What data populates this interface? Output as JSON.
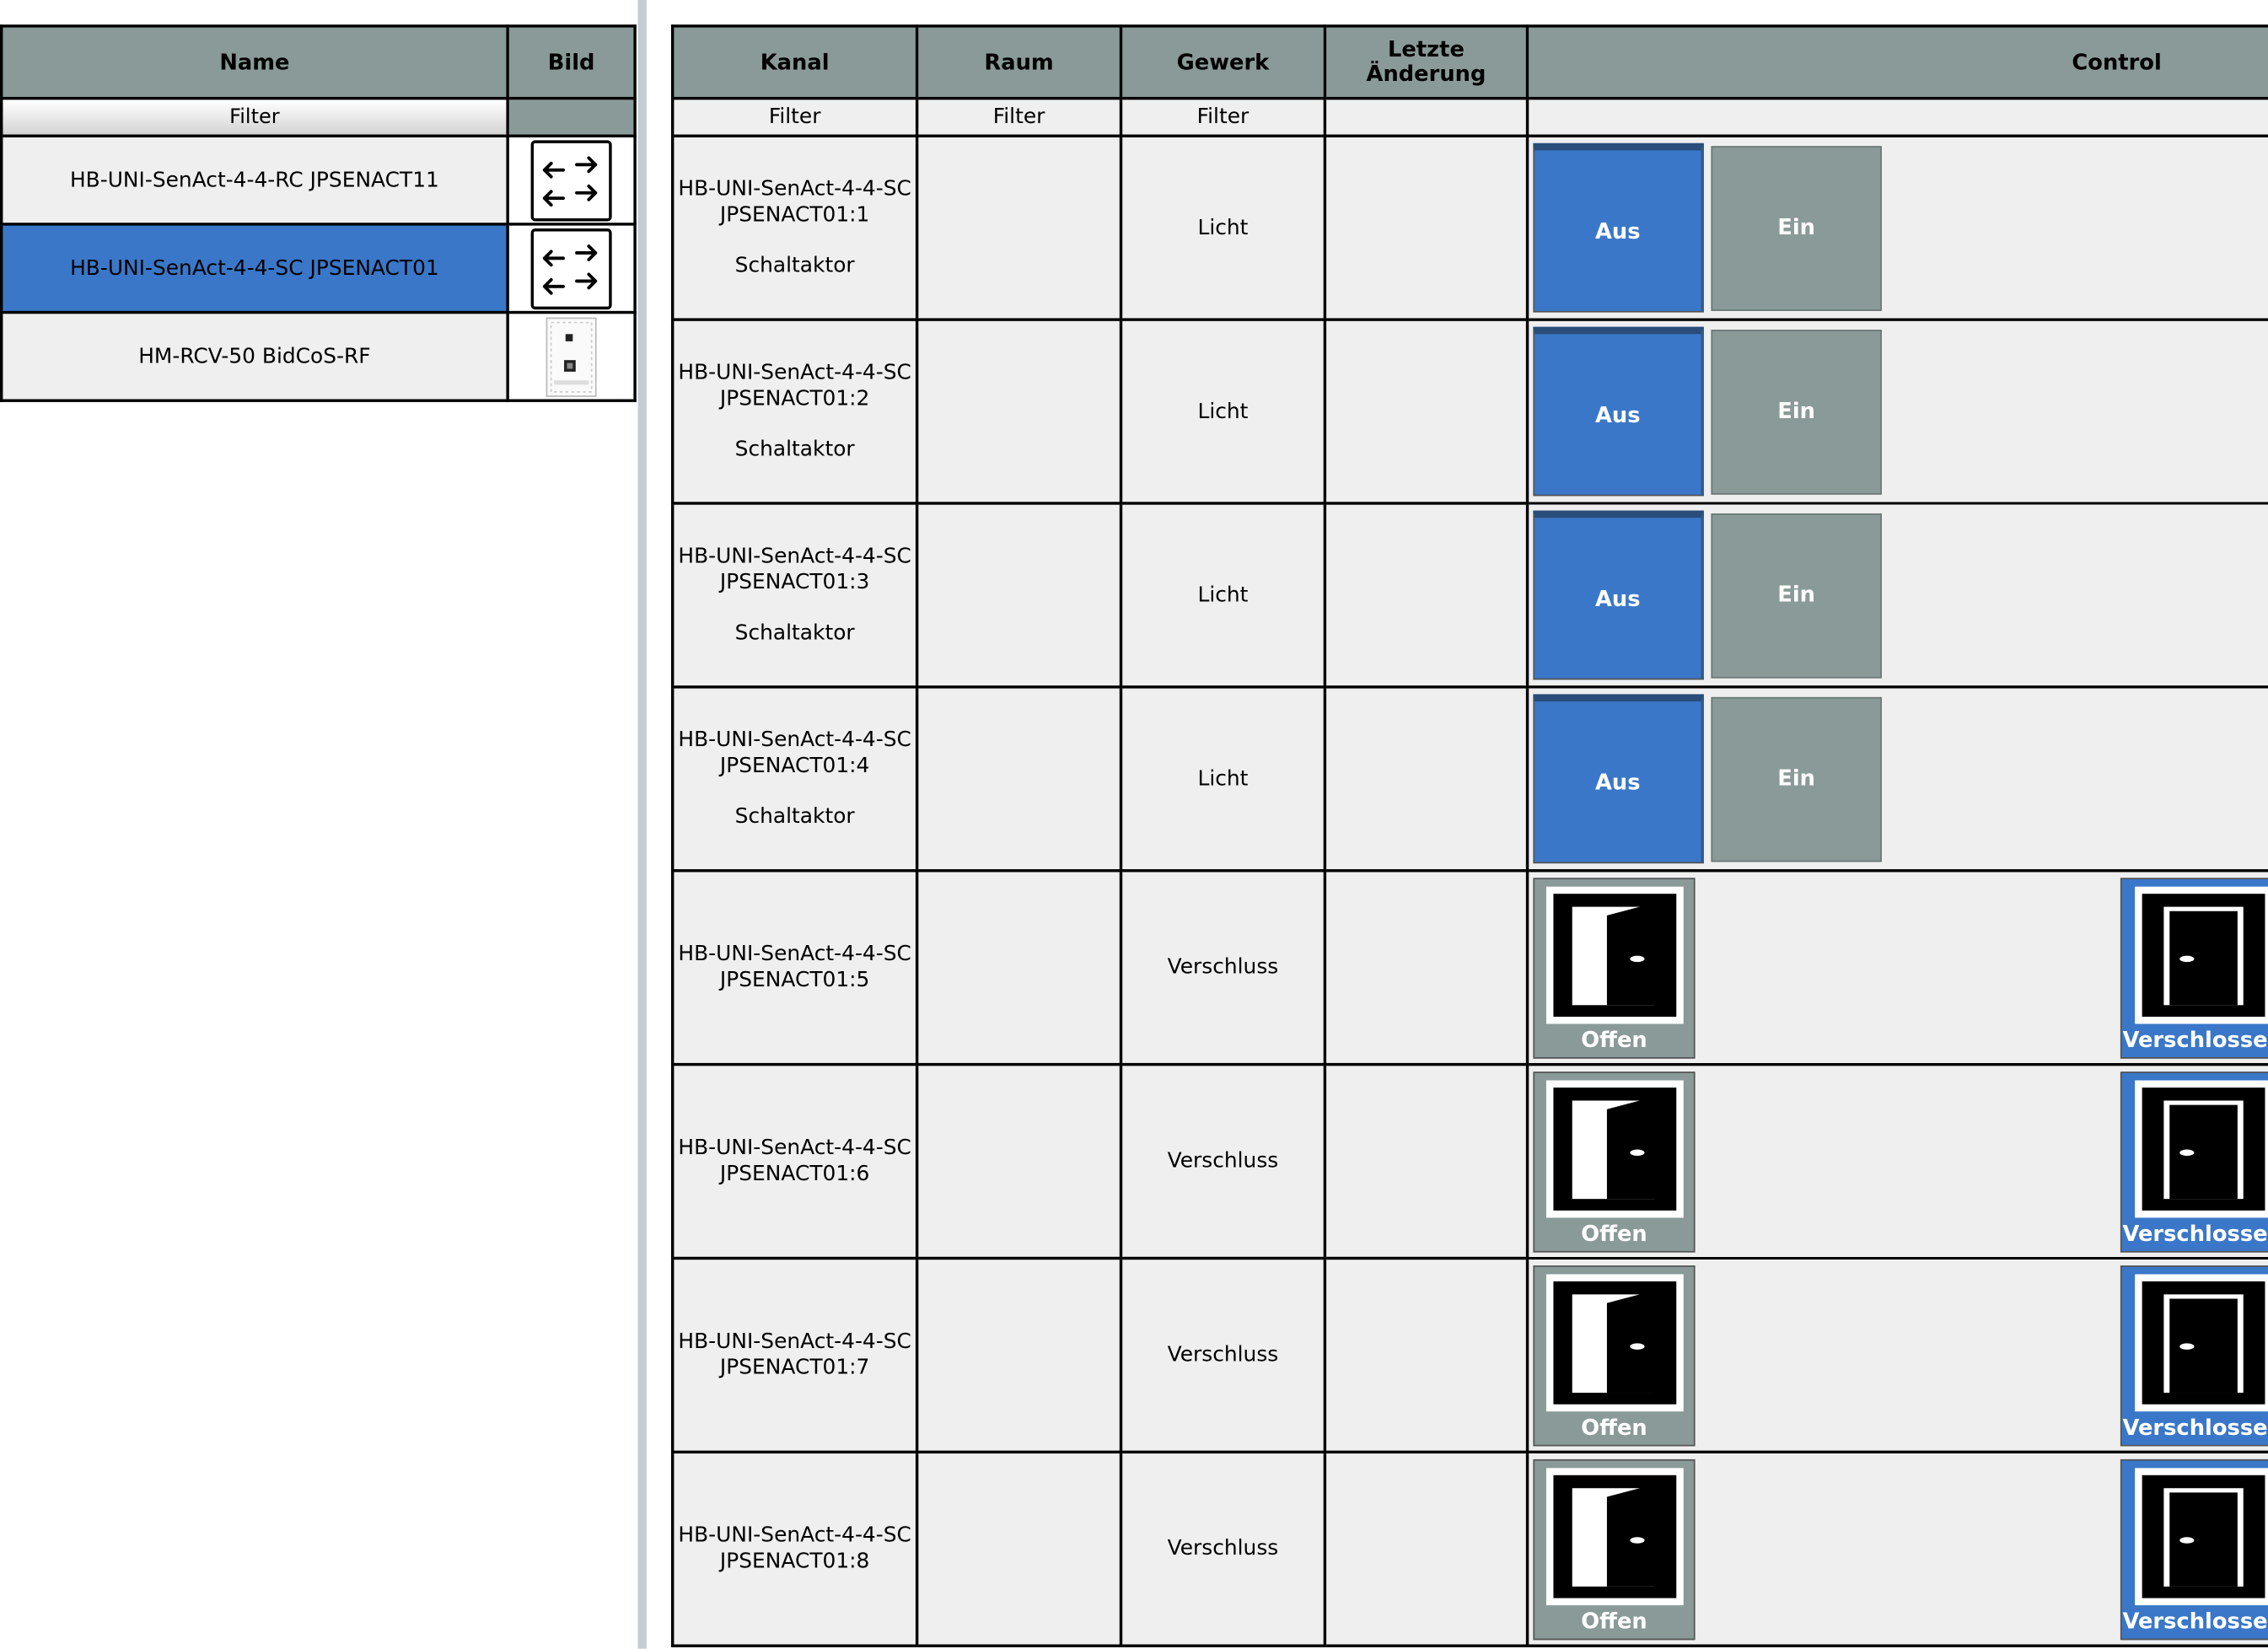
{
  "devices": {
    "headers": {
      "name": "Name",
      "image": "Bild"
    },
    "filter_label": "Filter",
    "rows": [
      {
        "name": "HB-UNI-SenAct-4-4-RC JPSENACT11",
        "icon": "arrows-icon",
        "selected": false
      },
      {
        "name": "HB-UNI-SenAct-4-4-SC JPSENACT01",
        "icon": "arrows-icon",
        "selected": true
      },
      {
        "name": "HM-RCV-50 BidCoS-RF",
        "icon": "rcv-device-icon",
        "selected": false
      }
    ]
  },
  "channels": {
    "headers": {
      "kanal": "Kanal",
      "raum": "Raum",
      "gewerk": "Gewerk",
      "letzte_line1": "Letzte",
      "letzte_line2": "Änderung",
      "control": "Control"
    },
    "filters": {
      "kanal": "Filter",
      "raum": "Filter",
      "gewerk": "Filter"
    },
    "switch_rows": [
      {
        "line1": "HB-UNI-SenAct-4-4-SC",
        "line2": "JPSENACT01:1",
        "type": "Schaltaktor",
        "raum": "",
        "gewerk": "Licht",
        "letzte": "",
        "off_label": "Aus",
        "on_label": "Ein",
        "state": "off"
      },
      {
        "line1": "HB-UNI-SenAct-4-4-SC",
        "line2": "JPSENACT01:2",
        "type": "Schaltaktor",
        "raum": "",
        "gewerk": "Licht",
        "letzte": "",
        "off_label": "Aus",
        "on_label": "Ein",
        "state": "off"
      },
      {
        "line1": "HB-UNI-SenAct-4-4-SC",
        "line2": "JPSENACT01:3",
        "type": "Schaltaktor",
        "raum": "",
        "gewerk": "Licht",
        "letzte": "",
        "off_label": "Aus",
        "on_label": "Ein",
        "state": "off"
      },
      {
        "line1": "HB-UNI-SenAct-4-4-SC",
        "line2": "JPSENACT01:4",
        "type": "Schaltaktor",
        "raum": "",
        "gewerk": "Licht",
        "letzte": "",
        "off_label": "Aus",
        "on_label": "Ein",
        "state": "off"
      }
    ],
    "lock_rows": [
      {
        "line1": "HB-UNI-SenAct-4-4-SC",
        "line2": "JPSENACT01:5",
        "raum": "",
        "gewerk": "Verschluss",
        "letzte": "",
        "open_label": "Offen",
        "closed_label": "Verschlossen",
        "state": "closed"
      },
      {
        "line1": "HB-UNI-SenAct-4-4-SC",
        "line2": "JPSENACT01:6",
        "raum": "",
        "gewerk": "Verschluss",
        "letzte": "",
        "open_label": "Offen",
        "closed_label": "Verschlossen",
        "state": "closed"
      },
      {
        "line1": "HB-UNI-SenAct-4-4-SC",
        "line2": "JPSENACT01:7",
        "raum": "",
        "gewerk": "Verschluss",
        "letzte": "",
        "open_label": "Offen",
        "closed_label": "Verschlossen",
        "state": "closed"
      },
      {
        "line1": "HB-UNI-SenAct-4-4-SC",
        "line2": "JPSENACT01:8",
        "raum": "",
        "gewerk": "Verschluss",
        "letzte": "",
        "open_label": "Offen",
        "closed_label": "Verschlossen",
        "state": "closed"
      }
    ]
  },
  "colors": {
    "header_gray": "#8a9a99",
    "active_blue": "#3a77c8",
    "cell_bg": "#efefef",
    "divider": "#c4cdd3"
  }
}
